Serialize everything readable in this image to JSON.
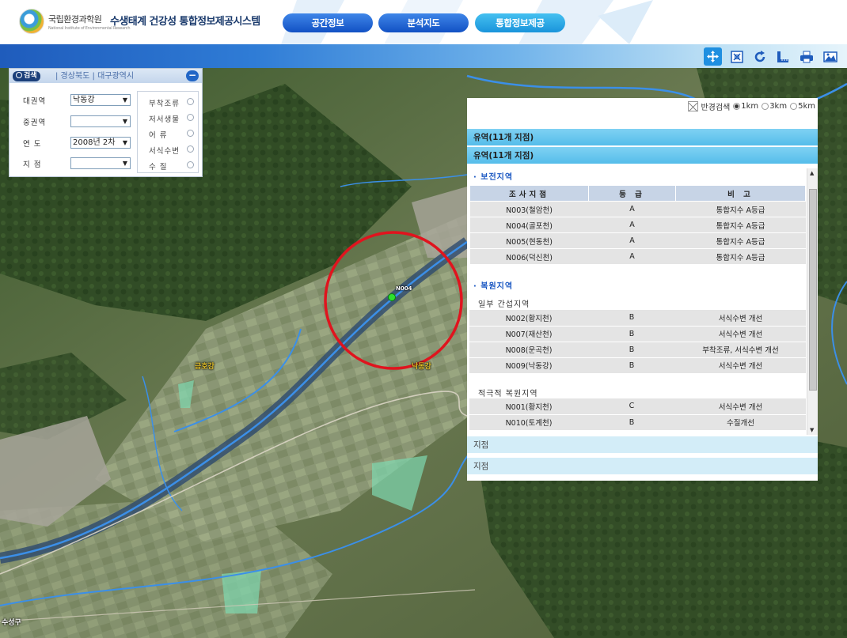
{
  "header": {
    "org_name": "국립환경과학원",
    "org_sub": "National Institute of Environmental Research",
    "site_title": "수생태계 건강성 통합정보제공시스템",
    "nav": [
      "공간정보",
      "분석지도",
      "통합정보제공"
    ]
  },
  "toolbar": {
    "tools": [
      "move-icon",
      "full-extent-icon",
      "refresh-icon",
      "measure-icon",
      "print-icon",
      "save-image-icon"
    ]
  },
  "search": {
    "tab_label": "검색",
    "region": "| 경상북도 | 대구광역시",
    "collapse": "−",
    "fields": [
      {
        "label": "대권역",
        "value": "낙동강"
      },
      {
        "label": "중권역",
        "value": ""
      },
      {
        "label": "연  도",
        "value": "2008년 2차"
      },
      {
        "label": "지  점",
        "value": ""
      }
    ],
    "options": [
      "부착조류",
      "저서생물",
      "어   류",
      "서식수변",
      "수   질"
    ]
  },
  "map": {
    "labels": [
      {
        "text": "금호강"
      },
      {
        "text": "낙동강"
      },
      {
        "text": "N004"
      },
      {
        "text": "수성구"
      }
    ],
    "colors": {
      "highlight_circle": "#e0141e",
      "site_marker": "#2ee02e",
      "river": "#3b8fe8"
    }
  },
  "results": {
    "radius": {
      "label": "반경검색",
      "options": [
        "1km",
        "3km",
        "5km"
      ],
      "selected": "1km"
    },
    "bar1": "유역(11개 지점)",
    "bar2": "유역(11개 지점)",
    "section_conservation": "· 보전지역",
    "section_restoration": "· 복원지역",
    "sub_partial": "일부 간섭지역",
    "sub_active": "적극적 복원지역",
    "columns": [
      "조사지점",
      "등 급",
      "비 고"
    ],
    "conservation_rows": [
      [
        "N003(철암천)",
        "A",
        "통합지수 A등급"
      ],
      [
        "N004(골포천)",
        "A",
        "통합지수 A등급"
      ],
      [
        "N005(현동천)",
        "A",
        "통합지수 A등급"
      ],
      [
        "N006(덕신천)",
        "A",
        "통합지수 A등급"
      ]
    ],
    "partial_rows": [
      [
        "N002(황지천)",
        "B",
        "서식수변 개선"
      ],
      [
        "N007(재산천)",
        "B",
        "서식수변 개선"
      ],
      [
        "N008(운곡천)",
        "B",
        "부착조류, 서식수변 개선"
      ],
      [
        "N009(낙동강)",
        "B",
        "서식수변 개선"
      ]
    ],
    "active_rows": [
      [
        "N001(황지천)",
        "C",
        "서식수변 개선"
      ],
      [
        "N010(토계천)",
        "B",
        "수질개선"
      ]
    ],
    "bar3": "지점",
    "bar4": "지점"
  }
}
